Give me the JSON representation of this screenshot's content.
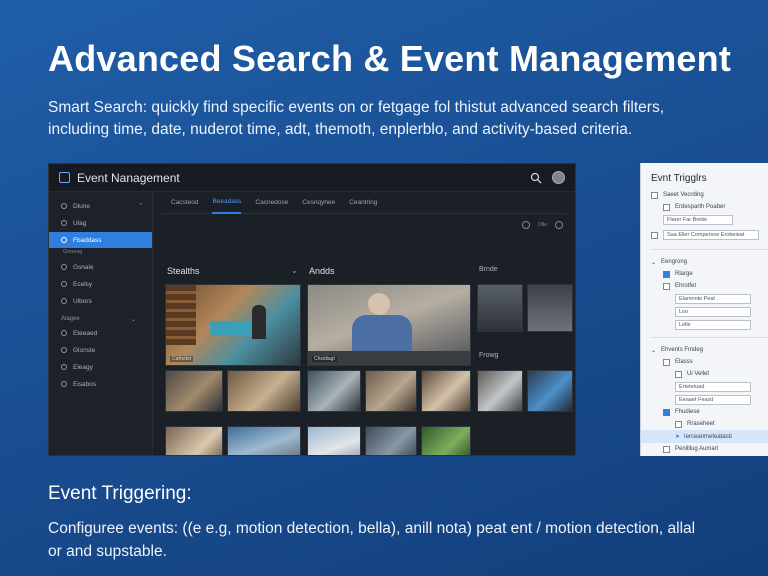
{
  "headline": "Advanced Search & Event Management",
  "intro": "Smart Search: quickly find specific events on or fetgage fol thistut advanced search filters, including time, date, nuderot time, adt, themoth, enplerblo, and activity-based criteria.",
  "app": {
    "title": "Event Nanagement",
    "sidebar": {
      "items": [
        {
          "label": "Dlune"
        },
        {
          "label": "Ulag"
        },
        {
          "label": "Fbaddass",
          "active": true
        },
        {
          "label": "Gsnale"
        },
        {
          "label": "Ecelsy"
        },
        {
          "label": "Ulbors"
        }
      ],
      "active_sub": "Gnnesg",
      "section_label": "Alagee",
      "section_items": [
        {
          "label": "Eteeaed"
        },
        {
          "label": "Glonste"
        },
        {
          "label": "Eleagy"
        },
        {
          "label": "Eisabos"
        }
      ]
    },
    "tabs": [
      "Cacsteod",
      "Beeadass",
      "Cacnedose",
      "Cesnqyhee",
      "Ceantring"
    ],
    "active_tab_index": 1,
    "toolbar_text": "Ofie",
    "sections": {
      "left": "Stealths",
      "middle": "Andds",
      "right_top": "Brnde",
      "right_mid": "Frowg"
    },
    "thumb_captions": [
      "Cafrettet",
      "Chsidiagt"
    ]
  },
  "panel": {
    "title": "Evnt Trigglrs",
    "rows": [
      "Saeet Vecrding",
      "Erdesparth Poaber",
      "Flarer Far Bretie",
      "Saa Eller Compersoe Erobeieat",
      "Eengrong",
      "Rlarge",
      "Ehrotfet",
      "Elamonte Peal",
      "Loo",
      "Lelle",
      "Ehvents Fmdeg",
      "Elasss",
      "Ui Vellet",
      "Ertetetuad",
      "Eeaaet Feasd",
      "Fhudiese",
      "Rraseheet",
      "Ierceanmeteatasti",
      "Penilllug Aumarl"
    ]
  },
  "heading2": "Event Triggering:",
  "closing": "Configuree events: ((e e.g, motion detection, bella), anill nota) peat ent / motion detection, allal or and supstable.",
  "colors": {
    "background": "#1a4f93",
    "accent": "#2f7fe0",
    "app_bg": "#1b1f26",
    "panel_bg": "#f3f5f8"
  }
}
